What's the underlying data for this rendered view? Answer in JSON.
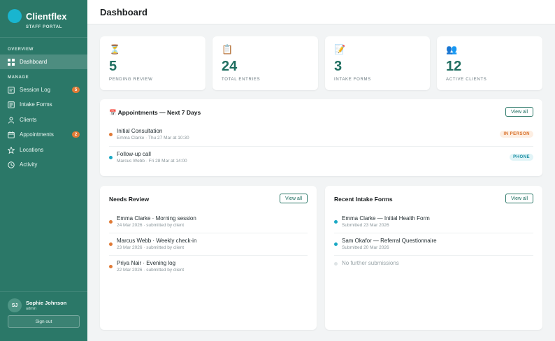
{
  "brand": {
    "name": "Clientflex",
    "subtitle": "STAFF PORTAL",
    "logo_color": "#19b5cf"
  },
  "colors": {
    "sidebar": "#2b7868",
    "accent": "#1f6e60",
    "orange": "#e07a36",
    "cyan": "#19a8c4"
  },
  "sidebar": {
    "sections": [
      {
        "label": "OVERVIEW"
      },
      {
        "label": "MANAGE"
      }
    ],
    "items": [
      {
        "label": "Dashboard",
        "icon": "grid-icon",
        "active": true
      },
      {
        "label": "Session Log",
        "icon": "log-icon",
        "badge": "5"
      },
      {
        "label": "Intake Forms",
        "icon": "form-icon"
      },
      {
        "label": "Clients",
        "icon": "user-icon"
      },
      {
        "label": "Appointments",
        "icon": "calendar-icon",
        "badge": "2"
      },
      {
        "label": "Locations",
        "icon": "star-icon"
      },
      {
        "label": "Activity",
        "icon": "clock-icon"
      }
    ]
  },
  "user": {
    "initials": "SJ",
    "name": "Sophie Johnson",
    "role": "admin",
    "signout_label": "Sign out"
  },
  "header": {
    "title": "Dashboard"
  },
  "stats": [
    {
      "icon": "⏳",
      "value": "5",
      "label": "PENDING REVIEW"
    },
    {
      "icon": "📋",
      "value": "24",
      "label": "TOTAL ENTRIES"
    },
    {
      "icon": "📝",
      "value": "3",
      "label": "INTAKE FORMS"
    },
    {
      "icon": "👥",
      "value": "12",
      "label": "ACTIVE CLIENTS"
    }
  ],
  "appointments": {
    "icon": "📅",
    "title": "Appointments — Next 7 Days",
    "view_all": "View all",
    "rows": [
      {
        "title": "Initial Consultation",
        "sub": "Emma Clarke · Thu 27 Mar at 10:30",
        "tag": "IN PERSON",
        "dot": "#e07a36"
      },
      {
        "title": "Follow-up call",
        "sub": "Marcus Webb · Fri 28 Mar at 14:00",
        "tag": "PHONE",
        "dot": "#19a8c4"
      }
    ]
  },
  "needs_review": {
    "title": "Needs Review",
    "view_all": "View all",
    "rows": [
      {
        "title": "Emma Clarke · Morning session",
        "sub": "24 Mar 2026 · submitted by client"
      },
      {
        "title": "Marcus Webb · Weekly check-in",
        "sub": "23 Mar 2026 · submitted by client"
      },
      {
        "title": "Priya Nair · Evening log",
        "sub": "22 Mar 2026 · submitted by client"
      }
    ]
  },
  "recent_intake": {
    "title": "Recent Intake Forms",
    "view_all": "View all",
    "rows": [
      {
        "title": "Emma Clarke — Initial Health Form",
        "sub": "Submitted 23 Mar 2026"
      },
      {
        "title": "Sam Okafor — Referral Questionnaire",
        "sub": "Submitted 20 Mar 2026"
      }
    ],
    "empty": "No further submissions"
  }
}
